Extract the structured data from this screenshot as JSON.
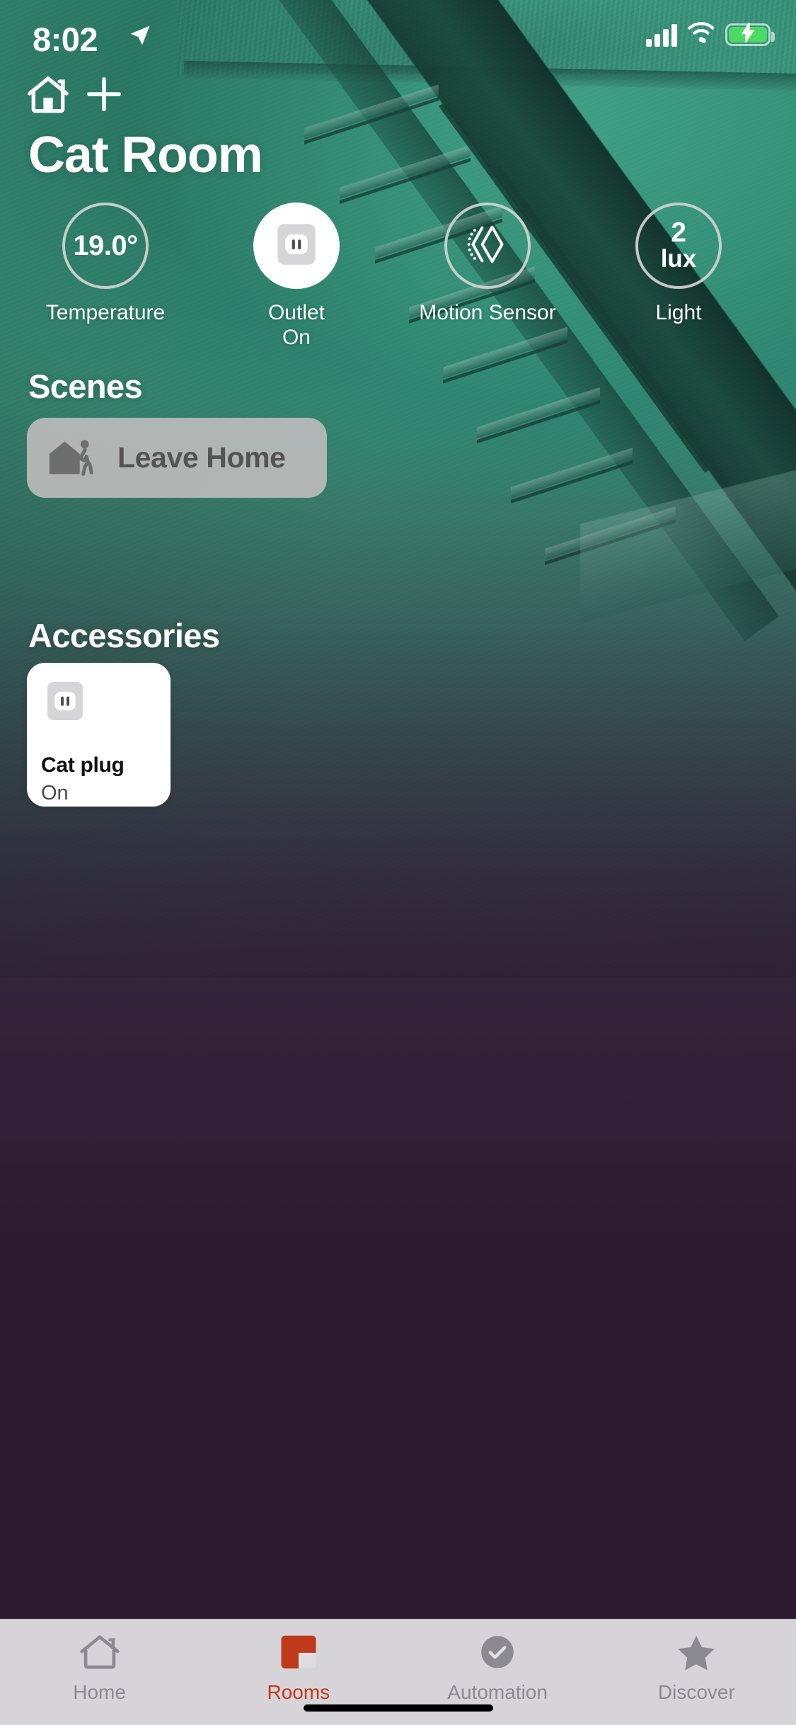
{
  "status_bar": {
    "time": "8:02",
    "location_icon": "location-arrow-icon",
    "signal_icon": "cellular-bars-icon",
    "wifi_icon": "wifi-icon",
    "battery_icon": "battery-charging-icon",
    "battery_color": "#4cd964"
  },
  "nav": {
    "home_icon": "home-icon",
    "add_icon": "plus-icon"
  },
  "header": {
    "title": "Cat Room"
  },
  "status_circles": [
    {
      "value": "19.0°",
      "unit": "",
      "label": "Temperature",
      "sub": "",
      "icon": "",
      "filled": false
    },
    {
      "value": "",
      "unit": "",
      "label": "Outlet",
      "sub": "On",
      "icon": "outlet-icon",
      "filled": true
    },
    {
      "value": "",
      "unit": "",
      "label": "Motion Sensor",
      "sub": "",
      "icon": "motion-sensor-icon",
      "filled": false
    },
    {
      "value": "2",
      "unit": "lux",
      "label": "Light",
      "sub": "",
      "icon": "",
      "filled": false
    }
  ],
  "scenes": {
    "heading": "Scenes",
    "items": [
      {
        "name": "Leave Home",
        "icon": "leave-home-icon"
      }
    ]
  },
  "accessories": {
    "heading": "Accessories",
    "items": [
      {
        "name": "Cat plug",
        "state": "On",
        "icon": "outlet-icon"
      }
    ]
  },
  "tab_bar": {
    "active": "Rooms",
    "accent_color": "#c0391b",
    "inactive_color": "#8c8a91",
    "tabs": [
      {
        "label": "Home",
        "icon": "home-icon"
      },
      {
        "label": "Rooms",
        "icon": "rooms-icon"
      },
      {
        "label": "Automation",
        "icon": "automation-clock-icon"
      },
      {
        "label": "Discover",
        "icon": "star-icon"
      }
    ]
  }
}
